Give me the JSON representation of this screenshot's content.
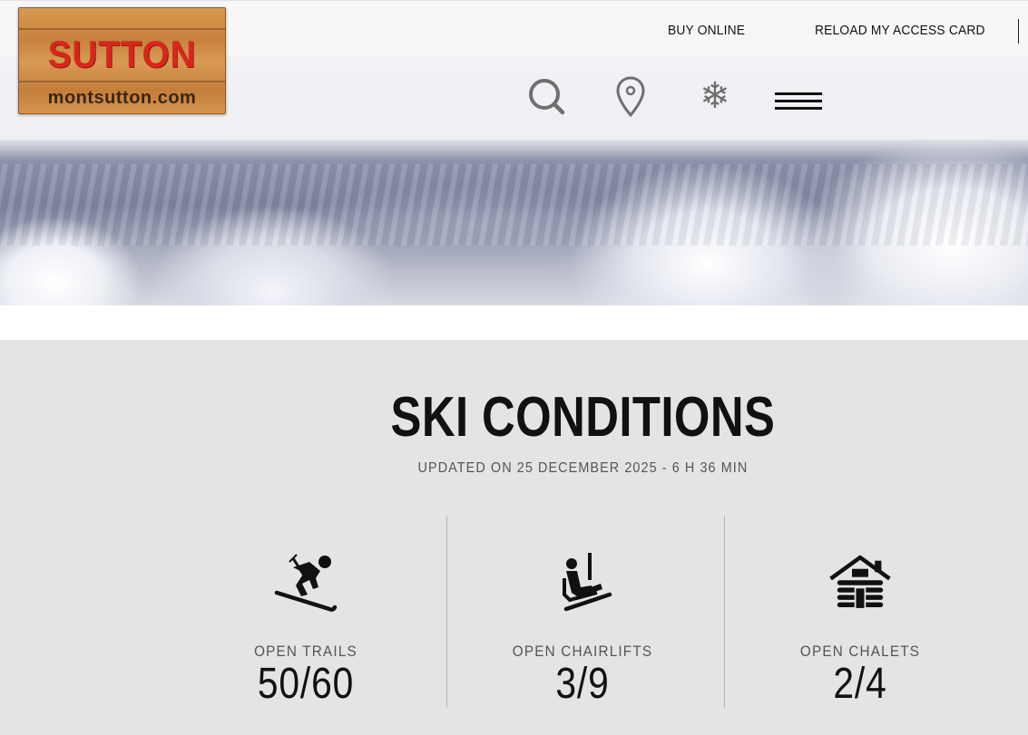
{
  "header": {
    "buy_online": "BUY ONLINE",
    "reload_access_card": "RELOAD MY ACCESS CARD"
  },
  "logo": {
    "title": "SUTTON",
    "subtitle": "montsutton.com"
  },
  "nav": {
    "search_icon": "search-icon",
    "location_icon": "map-pin-icon",
    "snow_icon": "snowflake-icon",
    "snow_glyph": "❄",
    "menu_icon": "hamburger-menu-icon"
  },
  "conditions": {
    "title": "SKI CONDITIONS",
    "updated": "UPDATED ON 25 DECEMBER 2025 - 6 H 36 MIN",
    "stats": [
      {
        "label": "OPEN TRAILS",
        "value": "50/60",
        "icon": "skier-icon"
      },
      {
        "label": "OPEN CHAIRLIFTS",
        "value": "3/9",
        "icon": "chairlift-icon"
      },
      {
        "label": "OPEN CHALETS",
        "value": "2/4",
        "icon": "log-cabin-icon"
      }
    ]
  },
  "colors": {
    "logo_red": "#d9261c",
    "wood": "#c8823e",
    "panel_bg": "#e4e4e4",
    "topbar_bg": "#f7f7f9"
  }
}
